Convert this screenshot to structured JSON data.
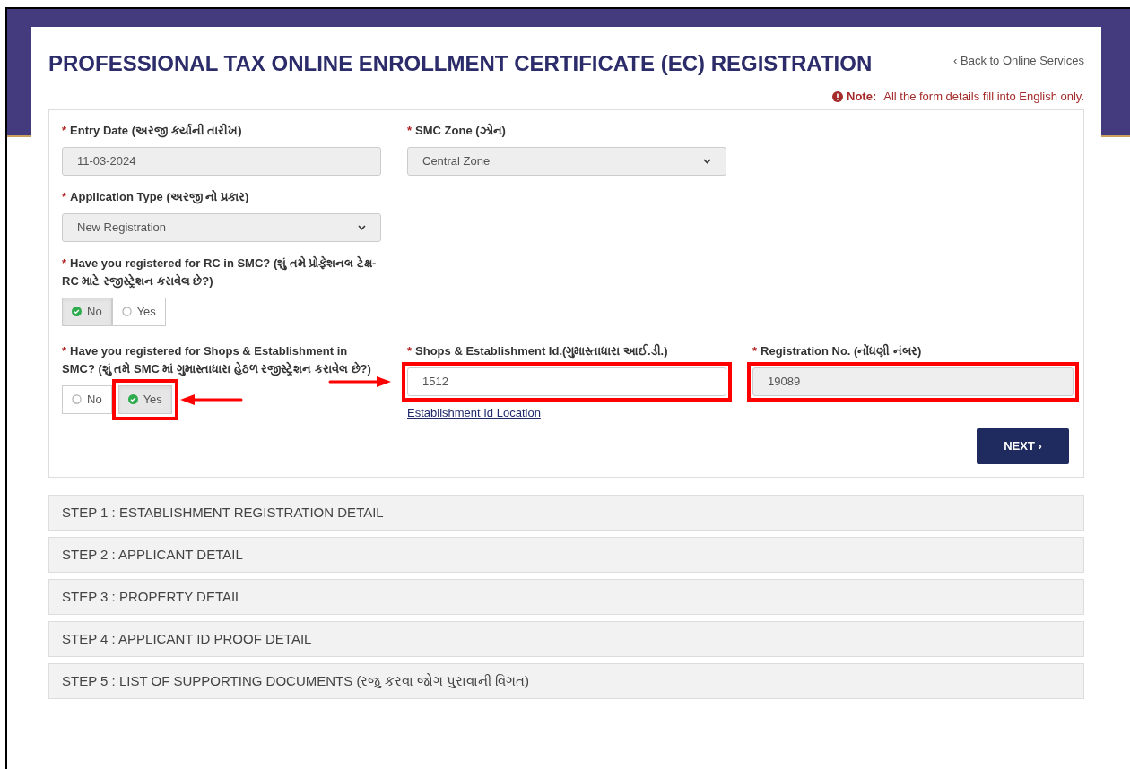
{
  "header": {
    "title": "PROFESSIONAL TAX ONLINE ENROLLMENT CERTIFICATE (EC) REGISTRATION",
    "back_link": "‹ Back to Online Services",
    "note_label": "Note:",
    "note_text": "All the form details fill into English only."
  },
  "form": {
    "rows": [
      {
        "fields": [
          {
            "kind": "text",
            "mark": "*",
            "label": "Entry Date (અરજી કર્યાની તારીખ)",
            "value": "11-03-2024",
            "readonly": true,
            "highlighted": false
          },
          {
            "kind": "select",
            "mark": "*",
            "label": "SMC Zone (ઝોન)",
            "value": "Central Zone",
            "readonly": true,
            "highlighted": false
          }
        ]
      },
      {
        "fields": [
          {
            "kind": "select",
            "mark": "*",
            "label": "Application Type (અરજી નો પ્રકાર)",
            "value": "New Registration",
            "readonly": true,
            "highlighted": false
          }
        ]
      },
      {
        "fields": [
          {
            "kind": "radio",
            "mark": "*",
            "label": "Have you registered for RC in SMC? (શું તમે પ્રોફેશનલ ટેક્ષ-RC માટે રજીસ્ટ્રેશન કરાવેલ છે?)",
            "options": [
              {
                "label": "No",
                "selected": true,
                "highlighted": false
              },
              {
                "label": "Yes",
                "selected": false,
                "highlighted": false
              }
            ]
          }
        ]
      },
      {
        "fields": [
          {
            "kind": "radio",
            "mark": "*",
            "label": "Have you registered for Shops & Establishment in SMC? (શું તમે SMC માં ગુમાસ્તાધારા હેઠળ રજીસ્ટ્રેશન કરાવેલ છે?)",
            "options": [
              {
                "label": "No",
                "selected": false,
                "highlighted": false
              },
              {
                "label": "Yes",
                "selected": true,
                "highlighted": true
              }
            ]
          },
          {
            "kind": "text",
            "mark": "*",
            "label": "Shops & Establishment Id.(ગુમાસ્તાધારા આઈ.ડી.)",
            "value": "1512",
            "readonly": false,
            "highlighted": true,
            "link": "Establishment Id Location"
          },
          {
            "kind": "text",
            "mark": "*",
            "label": "Registration No. (નોંધણી નંબર)",
            "value": "19089",
            "readonly": true,
            "highlighted": true
          }
        ]
      }
    ],
    "next_button": "NEXT ›"
  },
  "steps": [
    {
      "label": "STEP 1 : ESTABLISHMENT REGISTRATION DETAIL"
    },
    {
      "label": "STEP 2 : APPLICANT DETAIL"
    },
    {
      "label": "STEP 3 : PROPERTY DETAIL"
    },
    {
      "label": "STEP 4 : APPLICANT ID PROOF DETAIL"
    },
    {
      "label": "STEP 5 : LIST OF SUPPORTING DOCUMENTS (રજુ કરવા જોગ પુરાવાની વિગત)"
    }
  ]
}
